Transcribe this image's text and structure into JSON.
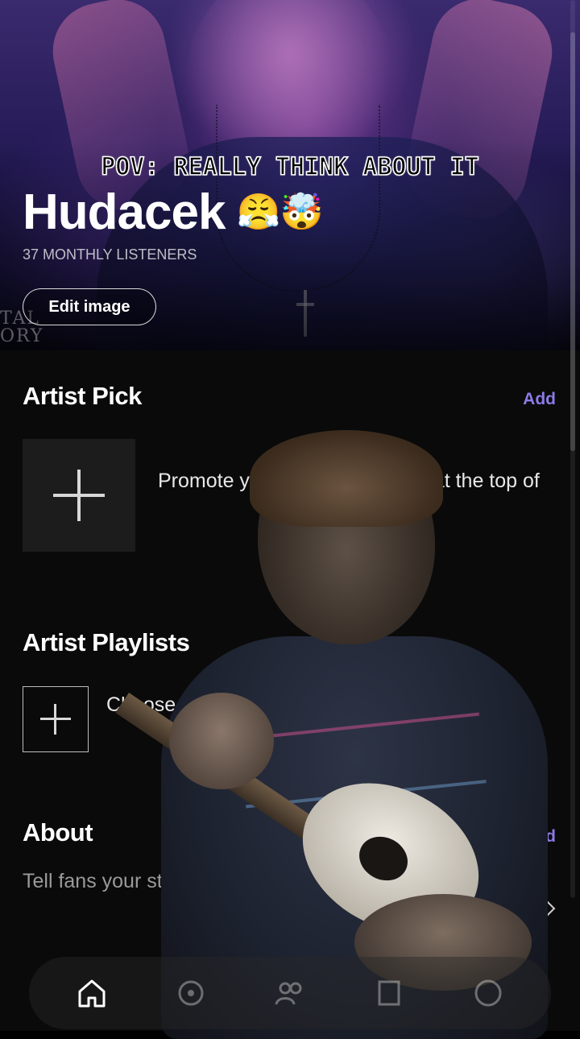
{
  "hero": {
    "caption": "POV: REALLY THINK ABOUT IT",
    "artist_name": "Hudacek",
    "artist_emoji": "😤🤯",
    "monthly_listeners": "37 MONTHLY LISTENERS",
    "edit_image_label": "Edit image",
    "corner_text": "TAL ORY"
  },
  "artist_pick": {
    "title": "Artist Pick",
    "add_label": "Add",
    "description": "Promote your ... feature music at the top of"
  },
  "artist_playlists": {
    "title": "Artist Playlists",
    "description": "Choose ... tify to featur"
  },
  "about": {
    "title": "About",
    "add_label": "Add",
    "description": "Tell fans your sto... want. You've got 1500 ch... own"
  },
  "bottom_nav": {
    "items": [
      {
        "icon": "home-icon"
      },
      {
        "icon": "music-icon"
      },
      {
        "icon": "audience-icon"
      },
      {
        "icon": "library-icon"
      },
      {
        "icon": "profile-icon"
      }
    ]
  },
  "colors": {
    "accent": "#8c7ae6",
    "background": "#0a0a0a",
    "hero_purple": "#3a2a6e"
  }
}
